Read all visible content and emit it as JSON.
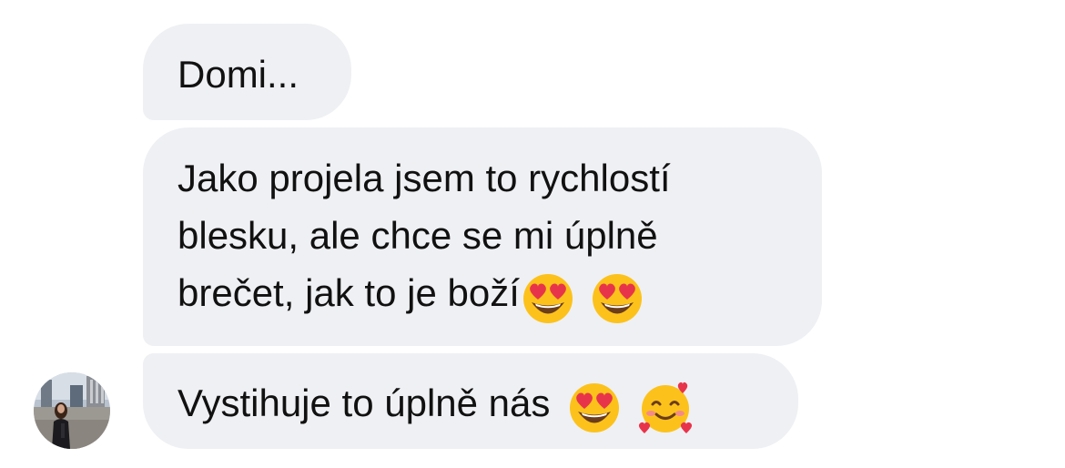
{
  "messages": [
    {
      "text": "Domi...",
      "emojis": []
    },
    {
      "text": "Jako projela jsem to rychlostí\nblesku, ale chce se mi úplně\nbrečet, jak to je boží",
      "emojis": [
        "heart-eyes-emoji",
        "heart-eyes-emoji"
      ]
    },
    {
      "text": "Vystihuje to úplně nás ",
      "emojis": [
        "heart-eyes-emoji",
        "smiling-face-with-hearts-emoji"
      ]
    }
  ],
  "colors": {
    "bubble_background": "#eff0f3",
    "text": "#111111",
    "emoji_face": "#fcc21b",
    "emoji_heart": "#e8344a"
  },
  "avatar": {
    "icon": "profile-photo-avatar"
  }
}
